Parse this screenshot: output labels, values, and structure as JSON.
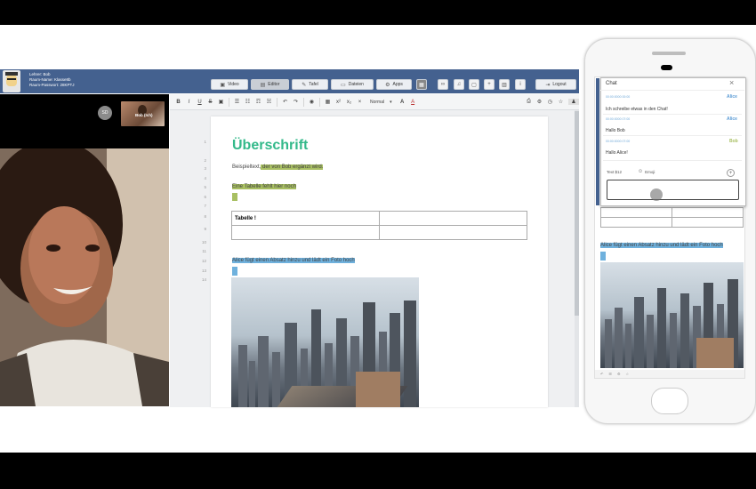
{
  "header": {
    "teacher_line": "Lehrer: Bob",
    "room_name_line": "Raum-Name: Klasse8b",
    "room_password_line": "Raum-Passwort: 28KPTJ",
    "nav": [
      {
        "label": "Video",
        "icon": "video-camera-icon"
      },
      {
        "label": "Editor",
        "icon": "document-icon"
      },
      {
        "label": "Tafel",
        "icon": "pencil-icon"
      },
      {
        "label": "Dateien",
        "icon": "folder-icon"
      },
      {
        "label": "Apps",
        "icon": "gear-icon"
      }
    ],
    "logout_label": "Logout"
  },
  "video": {
    "self_initials": "SD",
    "remote_name": "Bob (Ich)"
  },
  "toolbar": {
    "format_value": "Normal"
  },
  "editor": {
    "line_numbers": [
      "1",
      "2",
      "3",
      "4",
      "5",
      "6",
      "7",
      "8",
      "9",
      "10",
      "11",
      "12",
      "13",
      "14"
    ],
    "heading": "Überschrift",
    "p1_plain": "Beispieltext,",
    "p1_highlight": " der von Bob ergänzt wird.",
    "p2": "Eine Tabelle fehlt hier noch",
    "table_cell": "Tabelle !",
    "p3": "Alice fügt einen Absatz hinzu und lädt ein Foto hoch"
  },
  "chat": {
    "title": "Chat",
    "messages": [
      {
        "time": "00:00:0000 00:00",
        "name": "Alice",
        "text": "Ich schreibe etwas in den Chat!",
        "name_color": "#5b9bd5"
      },
      {
        "time": "00:00:0000 07:00",
        "name": "Alice",
        "text": "Hallo Bob",
        "name_color": "#5b9bd5"
      },
      {
        "time": "00:00:0000 07:00",
        "name": "Bob",
        "text": "Hallo Alice!",
        "name_color": "#a8bf62"
      }
    ],
    "text_option": "Text $12",
    "emoji_option": "Emoji"
  },
  "mobile": {
    "paragraph": "Alice fügt einen Absatz hinzu und lädt ein Foto hoch"
  },
  "colors": {
    "header": "#44618f",
    "heading": "#33b98a",
    "highlight_green": "#a8bf62",
    "highlight_blue": "#6fb1dd"
  }
}
